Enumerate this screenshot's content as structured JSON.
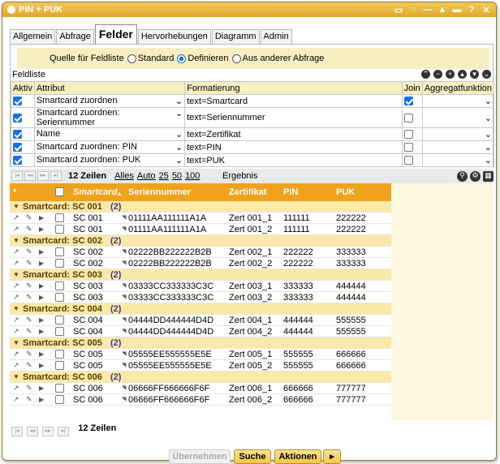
{
  "window": {
    "title": "PIN + PUK",
    "controls": [
      "▭",
      "◌",
      "—",
      "▲",
      "▬",
      "?",
      "✕"
    ]
  },
  "tabs": [
    "Allgemein",
    "Abfrage",
    "Felder",
    "Hervorhebungen",
    "Diagramm",
    "Admin"
  ],
  "active_tab": "Felder",
  "quelle": {
    "label": "Quelle für Feldliste",
    "options": [
      "Standard",
      "Definieren",
      "Aus anderer Abfrage"
    ],
    "selected": "Definieren"
  },
  "feldliste": {
    "title": "Feldliste",
    "headers": {
      "aktiv": "Aktiv",
      "attribut": "Attribut",
      "formatierung": "Formatierung",
      "join": "Join",
      "aggregat": "Aggregatfunktion"
    },
    "rows": [
      {
        "aktiv": true,
        "attribut": "Smartcard zuordnen",
        "formatierung": "text=Smartcard",
        "join": true
      },
      {
        "aktiv": true,
        "attribut": "Smartcard zuordnen: Seriennummer",
        "formatierung": "text=Seriennummer",
        "join": false
      },
      {
        "aktiv": true,
        "attribut": "Name",
        "formatierung": "text=Zertifikat",
        "join": false
      },
      {
        "aktiv": true,
        "attribut": "Smartcard zuordnen: PIN",
        "formatierung": "text=PIN",
        "join": false
      },
      {
        "aktiv": true,
        "attribut": "Smartcard zuordnen: PUK",
        "formatierung": "text=PUK",
        "join": false
      }
    ]
  },
  "pager": {
    "count": "12 Zeilen",
    "links": [
      "Alles",
      "Auto",
      "25",
      "50",
      "100"
    ],
    "ergebnis": "Ergebnis"
  },
  "grid": {
    "headers": {
      "star": "*",
      "smartcard": "Smartcard",
      "sort": "▲",
      "seriennummer": "Seriennummer",
      "zertifikat": "Zertifikat",
      "pin": "PIN",
      "puk": "PUK"
    },
    "groups": [
      {
        "label": "Smartcard: SC 001",
        "count": "(2)",
        "rows": [
          {
            "sc": "SC 001",
            "serial": "01111AA111111A1A",
            "zert": "Zert 001_1",
            "pin": "111111",
            "puk": "222222"
          },
          {
            "sc": "SC 001",
            "serial": "01111AA111111A1A",
            "zert": "Zert 001_2",
            "pin": "111111",
            "puk": "222222"
          }
        ]
      },
      {
        "label": "Smartcard: SC 002",
        "count": "(2)",
        "rows": [
          {
            "sc": "SC 002",
            "serial": "02222BB222222B2B",
            "zert": "Zert 002_1",
            "pin": "222222",
            "puk": "333333"
          },
          {
            "sc": "SC 002",
            "serial": "02222BB222222B2B",
            "zert": "Zert 002_2",
            "pin": "222222",
            "puk": "333333"
          }
        ]
      },
      {
        "label": "Smartcard: SC 003",
        "count": "(2)",
        "rows": [
          {
            "sc": "SC 003",
            "serial": "03333CC333333C3C",
            "zert": "Zert 003_1",
            "pin": "333333",
            "puk": "444444"
          },
          {
            "sc": "SC 003",
            "serial": "03333CC333333C3C",
            "zert": "Zert 003_2",
            "pin": "333333",
            "puk": "444444"
          }
        ]
      },
      {
        "label": "Smartcard: SC 004",
        "count": "(2)",
        "rows": [
          {
            "sc": "SC 004",
            "serial": "04444DD444444D4D",
            "zert": "Zert 004_1",
            "pin": "444444",
            "puk": "555555"
          },
          {
            "sc": "SC 004",
            "serial": "04444DD444444D4D",
            "zert": "Zert 004_2",
            "pin": "444444",
            "puk": "555555"
          }
        ]
      },
      {
        "label": "Smartcard: SC 005",
        "count": "(2)",
        "rows": [
          {
            "sc": "SC 005",
            "serial": "05555EE555555E5E",
            "zert": "Zert 005_1",
            "pin": "555555",
            "puk": "666666"
          },
          {
            "sc": "SC 005",
            "serial": "05555EE555555E5E",
            "zert": "Zert 005_2",
            "pin": "555555",
            "puk": "666666"
          }
        ]
      },
      {
        "label": "Smartcard: SC 006",
        "count": "(2)",
        "rows": [
          {
            "sc": "SC 006",
            "serial": "06666FF666666F6F",
            "zert": "Zert 006_1",
            "pin": "666666",
            "puk": "777777"
          },
          {
            "sc": "SC 006",
            "serial": "06666FF666666F6F",
            "zert": "Zert 006_2",
            "pin": "666666",
            "puk": "777777"
          }
        ]
      }
    ]
  },
  "footer": {
    "count": "12 Zeilen",
    "buttons": {
      "uebernehmen": "Übernehmen",
      "suche": "Suche",
      "aktionen": "Aktionen",
      "more": "▸"
    }
  },
  "colors": {
    "accent": "#efa21d",
    "group_row": "#fbe9a8",
    "header_bar": "#e0a82a",
    "check": "#1a6fe0"
  }
}
